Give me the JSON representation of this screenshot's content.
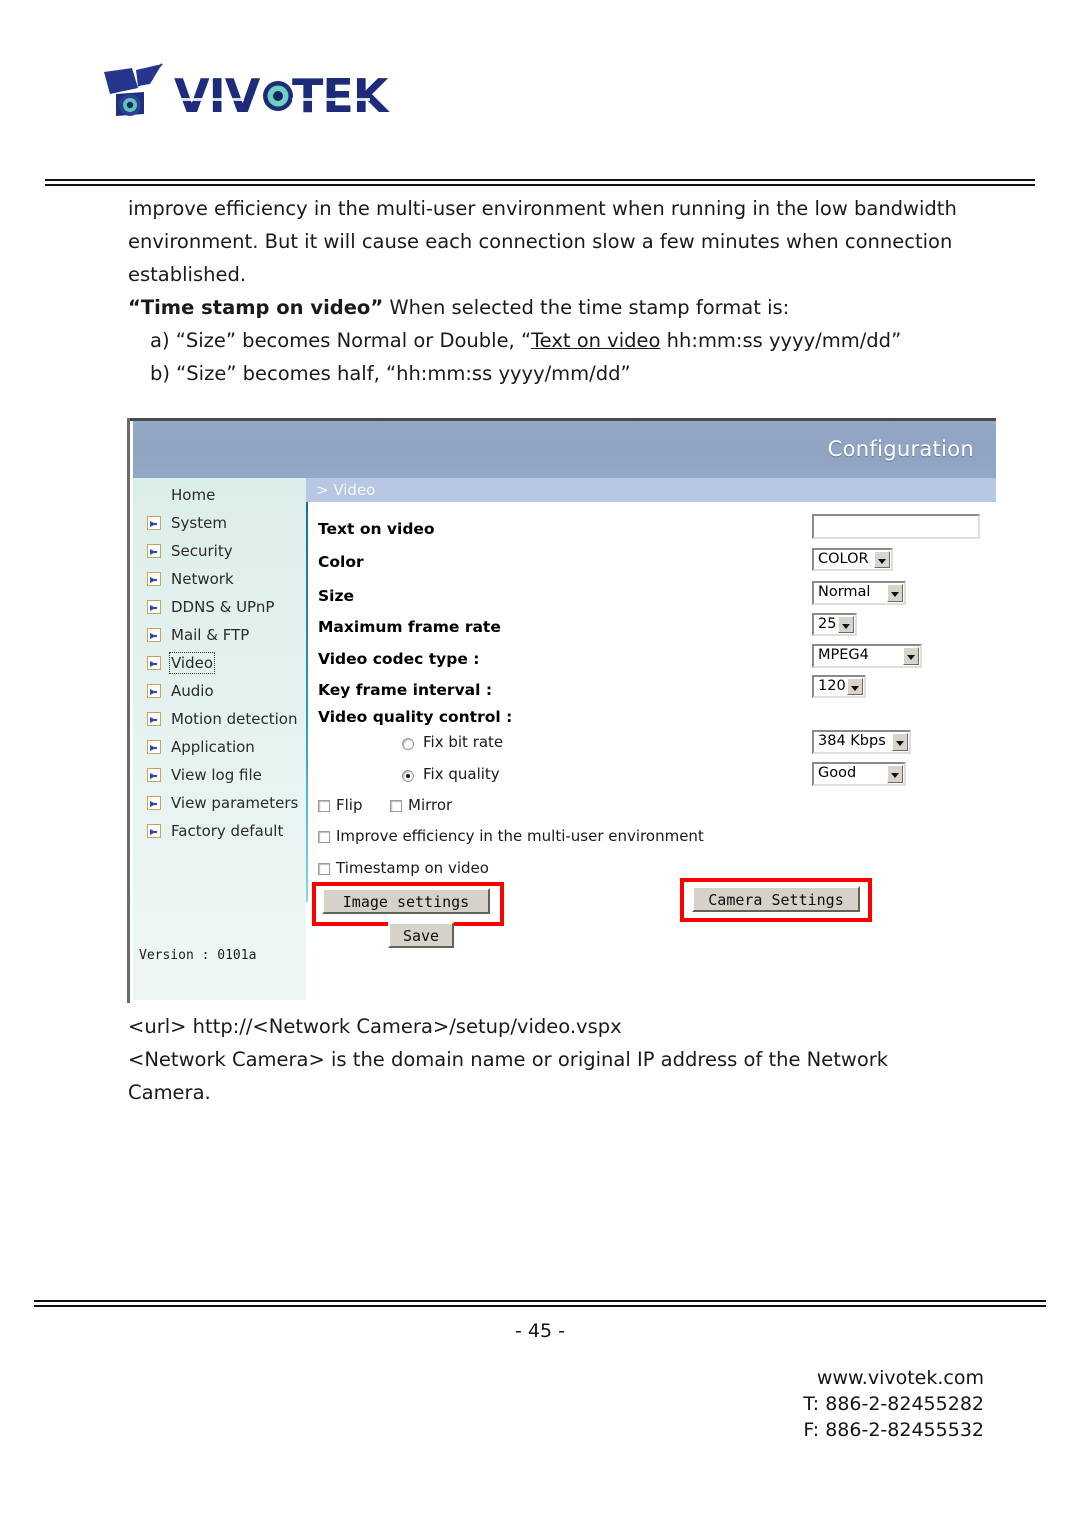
{
  "brand": {
    "logo_text": "VIVOTEK",
    "logo_icon": "camera-logo-icon"
  },
  "body_copy": {
    "p1_line1": "improve efficiency in the multi-user environment when running in the low bandwidth",
    "p1_line2": "environment. But it will cause each connection slow a few minutes when connection",
    "p1_line3": "established.",
    "p2_bold": "“Time stamp on video”",
    "p2_rest": " When selected the time stamp format is:",
    "item_a_pre": "a) “Size” becomes Normal or Double, “",
    "item_a_underlined": "Text on video",
    "item_a_post": " hh:mm:ss yyyy/mm/dd”",
    "item_b": "b) “Size” becomes half, “hh:mm:ss yyyy/mm/dd”"
  },
  "screenshot": {
    "header_title": "Configuration",
    "breadcrumb": "> Video",
    "sidebar": {
      "items": [
        {
          "label": "Home",
          "has_arrow": false,
          "active": false
        },
        {
          "label": "System",
          "has_arrow": true,
          "active": false
        },
        {
          "label": "Security",
          "has_arrow": true,
          "active": false
        },
        {
          "label": "Network",
          "has_arrow": true,
          "active": false
        },
        {
          "label": "DDNS & UPnP",
          "has_arrow": true,
          "active": false
        },
        {
          "label": "Mail & FTP",
          "has_arrow": true,
          "active": false
        },
        {
          "label": "Video",
          "has_arrow": true,
          "active": true
        },
        {
          "label": "Audio",
          "has_arrow": true,
          "active": false
        },
        {
          "label": "Motion detection",
          "has_arrow": true,
          "active": false
        },
        {
          "label": "Application",
          "has_arrow": true,
          "active": false
        },
        {
          "label": "View log file",
          "has_arrow": true,
          "active": false
        },
        {
          "label": "View parameters",
          "has_arrow": true,
          "active": false
        },
        {
          "label": "Factory default",
          "has_arrow": true,
          "active": false
        }
      ],
      "version": "Version : 0101a"
    },
    "form": {
      "text_on_video_label": "Text on video",
      "text_on_video_value": "",
      "text_on_video_placeholder": "",
      "color_label": "Color",
      "color_value": "COLOR",
      "size_label": "Size",
      "size_value": "Normal",
      "max_frame_rate_label": "Maximum frame rate",
      "max_frame_rate_value": "25",
      "codec_label": "Video codec type :",
      "codec_value": "MPEG4",
      "key_frame_label": "Key frame interval :",
      "key_frame_value": "120",
      "quality_control_label": "Video quality control :",
      "fix_bit_rate_label": "Fix bit rate",
      "fix_bit_rate_selected": false,
      "fix_bit_rate_value": "384 Kbps",
      "fix_quality_label": "Fix quality",
      "fix_quality_selected": true,
      "fix_quality_value": "Good",
      "flip_label": "Flip",
      "flip_checked": false,
      "mirror_label": "Mirror",
      "mirror_checked": false,
      "improve_label": "Improve efficiency in the multi-user environment",
      "improve_checked": false,
      "timestamp_label": "Timestamp on video",
      "timestamp_checked": false,
      "image_settings_button": "Image settings",
      "camera_settings_button": "Camera  Settings",
      "save_button": "Save"
    },
    "colors": {
      "header_blue": "#8fa4c3",
      "breadcrumb_blue": "#b7c7e4",
      "sidebar_mint": "#e4f2ef",
      "highlight_red": "#ff0000",
      "arrow_icon_border": "#c9a45c",
      "arrow_icon_fill": "#2d4fae"
    }
  },
  "url_notes": {
    "line1": "<url> http://<Network Camera>/setup/video.vspx",
    "line2": "<Network Camera> is the domain name or original IP address of the Network",
    "line3": "Camera."
  },
  "footer": {
    "page_number": "- 45 -",
    "website": "www.vivotek.com",
    "tel": "T: 886-2-82455282",
    "fax": "F: 886-2-82455532"
  }
}
